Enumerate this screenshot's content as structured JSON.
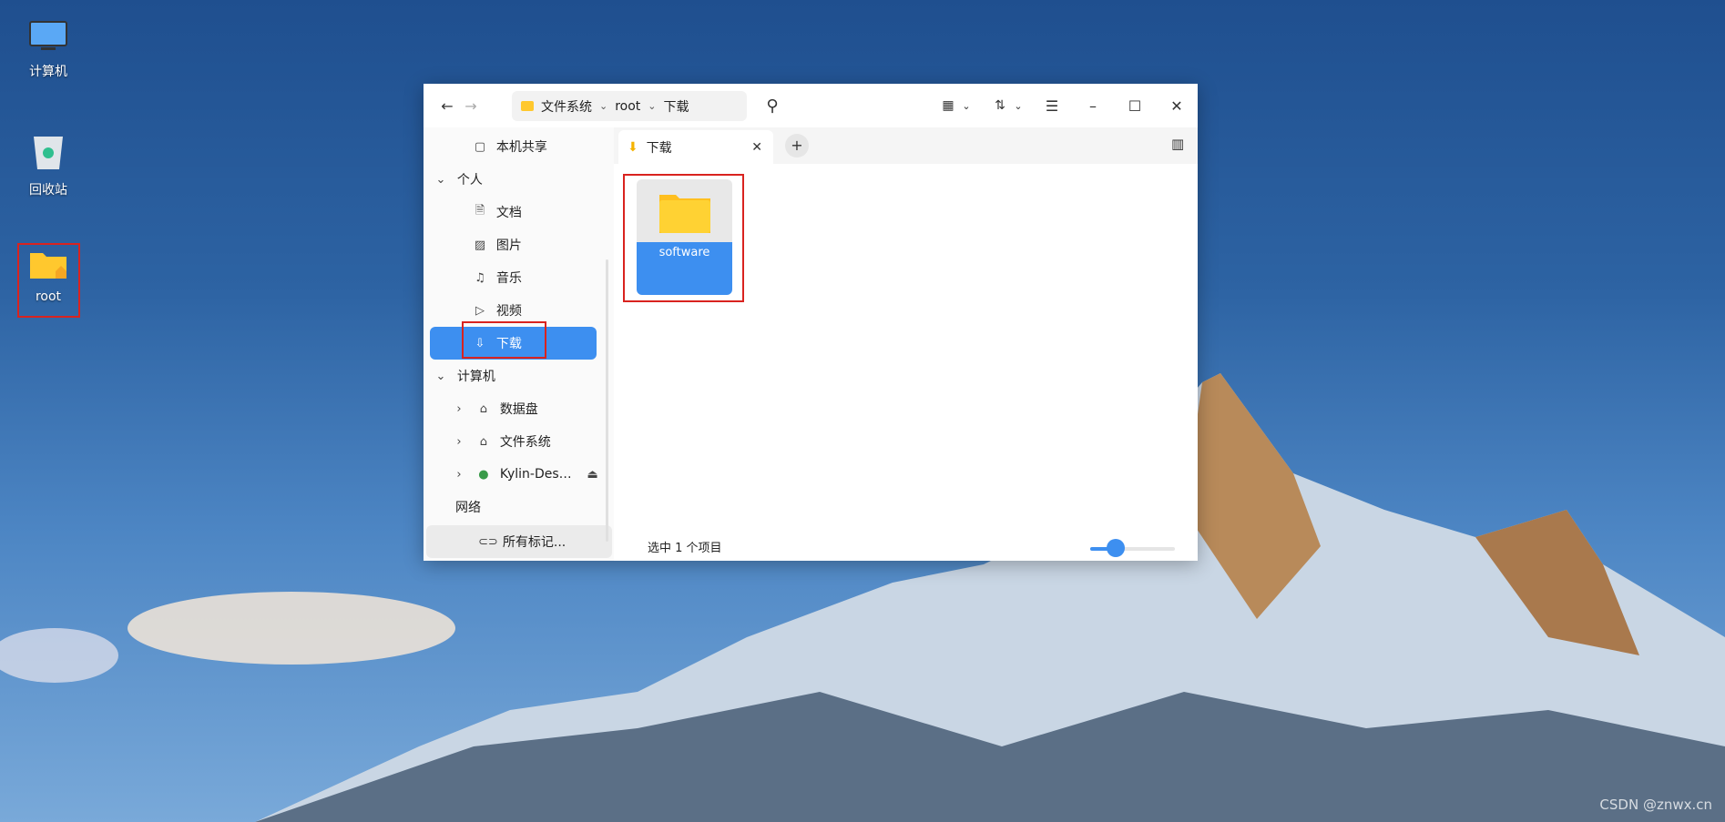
{
  "desktop": {
    "icons": [
      {
        "label": "计算机",
        "icon": "computer-icon"
      },
      {
        "label": "回收站",
        "icon": "trash-icon"
      },
      {
        "label": "root",
        "icon": "home-folder-icon"
      }
    ]
  },
  "window": {
    "breadcrumb": [
      "文件系统",
      "root",
      "下载"
    ],
    "sidebar": {
      "items": [
        {
          "label": "本机共享",
          "icon": "share-folder-icon"
        },
        {
          "label": "个人",
          "section": true
        },
        {
          "label": "文档",
          "icon": "document-icon"
        },
        {
          "label": "图片",
          "icon": "picture-icon"
        },
        {
          "label": "音乐",
          "icon": "music-icon"
        },
        {
          "label": "视频",
          "icon": "video-icon"
        },
        {
          "label": "下载",
          "icon": "download-icon",
          "selected": true
        },
        {
          "label": "计算机",
          "section": true
        },
        {
          "label": "数据盘",
          "icon": "drive-icon"
        },
        {
          "label": "文件系统",
          "icon": "drive-icon"
        },
        {
          "label": "Kylin-Des…",
          "icon": "disc-icon"
        },
        {
          "label": "网络",
          "section": true
        },
        {
          "label": "所有标记...",
          "icon": "tag-icon"
        }
      ]
    },
    "tab": {
      "label": "下载"
    },
    "files": [
      {
        "name": "software",
        "type": "folder",
        "selected": true
      }
    ],
    "status": "选中 1 个项目",
    "zoom_level_fraction": 0.3
  },
  "colors": {
    "accent": "#3d8ff0",
    "highlight": "#d9231f"
  },
  "watermark": "CSDN @znwx.cn"
}
